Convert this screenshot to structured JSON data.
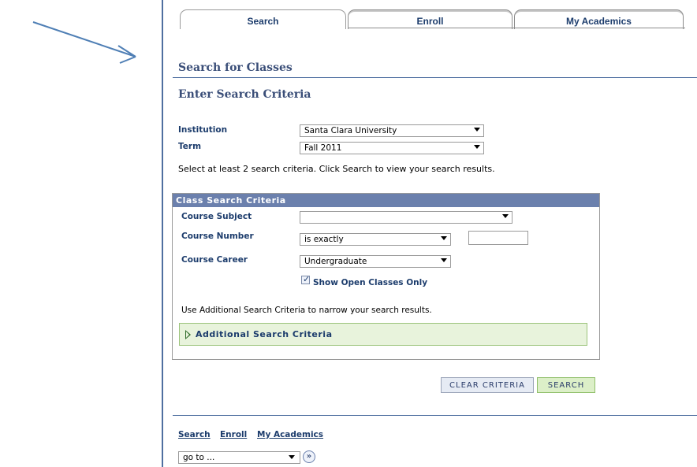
{
  "tabs": [
    {
      "label": "Search",
      "active": true
    },
    {
      "label": "Enroll",
      "active": false
    },
    {
      "label": "My Academics",
      "active": false
    }
  ],
  "page_title": "Search for Classes",
  "subtitle": "Enter Search Criteria",
  "institution": {
    "label": "Institution",
    "value": "Santa Clara University"
  },
  "term": {
    "label": "Term",
    "value": "Fall 2011"
  },
  "instructions": "Select at least 2 search criteria. Click Search to view your search results.",
  "criteria": {
    "header": "Class Search Criteria",
    "course_subject": {
      "label": "Course Subject",
      "value": ""
    },
    "course_number": {
      "label": "Course Number",
      "operator": "is exactly",
      "value": ""
    },
    "course_career": {
      "label": "Course Career",
      "value": "Undergraduate"
    },
    "open_only": {
      "label": "Show Open Classes Only",
      "checked": true
    },
    "note": "Use Additional Search Criteria to narrow your search results.",
    "additional": "Additional Search Criteria"
  },
  "buttons": {
    "clear": "CLEAR CRITERIA",
    "search": "SEARCH"
  },
  "footer": {
    "links": [
      "Search",
      "Enroll",
      "My Academics"
    ],
    "goto": "go to ...",
    "go_icon": "double-chevron-right-icon"
  },
  "colors": {
    "accent": "#3a4e78",
    "header_bar": "#6b80ad",
    "arrow": "#4f7fb5",
    "green_panel": "#e8f3dc"
  }
}
